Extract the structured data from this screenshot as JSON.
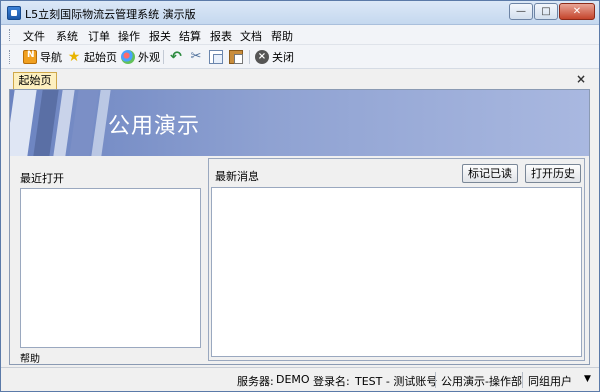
{
  "window": {
    "title": "L5立刻国际物流云管理系统 演示版",
    "controls": {
      "minimize": "—",
      "maximize": "□",
      "close": "✕"
    }
  },
  "menu": {
    "items": [
      {
        "label": "文件"
      },
      {
        "label": "系统"
      },
      {
        "label": "订单"
      },
      {
        "label": "操作"
      },
      {
        "label": "报关"
      },
      {
        "label": "结算"
      },
      {
        "label": "报表"
      },
      {
        "label": "文档"
      },
      {
        "label": "帮助"
      }
    ]
  },
  "toolbar": {
    "nav_label": "导航",
    "home_label": "起始页",
    "view_label": "外观",
    "close_label": "关闭",
    "icons": [
      "nav-icon",
      "star-icon",
      "appearance-icon",
      "back-icon",
      "cut-icon",
      "copy-icon",
      "paste-icon",
      "close-icon"
    ]
  },
  "tabs": {
    "active_label": "起始页",
    "close_glyph": "×"
  },
  "banner": {
    "title": "公用演示"
  },
  "left_panel": {
    "title": "最近打开",
    "help_label": "帮助"
  },
  "right_panel": {
    "title": "最新消息",
    "mark_read_label": "标记已读",
    "history_label": "打开历史"
  },
  "status": {
    "server_label": "服务器:",
    "server_value": "DEMO",
    "login_label": "登录名:",
    "login_value": "TEST - 测试账号",
    "department": "公用演示-操作部",
    "group_user": "同组用户"
  },
  "colors": {
    "banner_start": "#6b83c0",
    "banner_end": "#a9b8e0",
    "tab_active": "#fdf0c0",
    "close_button": "#c4442b"
  }
}
